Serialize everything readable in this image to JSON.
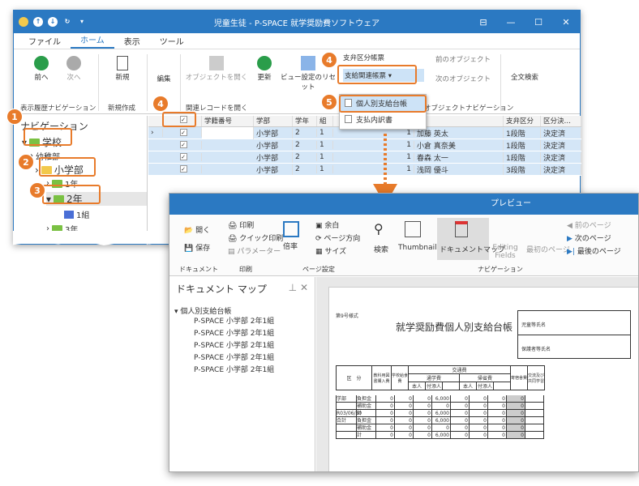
{
  "window": {
    "title": "児童生徒 - P-SPACE 就学奨励費ソフトウェア",
    "controls": [
      "⊟",
      "—",
      "☐",
      "✕"
    ]
  },
  "menu": [
    "ファイル",
    "ホーム",
    "表示",
    "ツール"
  ],
  "ribbon": {
    "back": "前へ",
    "forward": "次へ",
    "new": "新規",
    "edit": "編集",
    "open_object": "オブジェクトを開く",
    "refresh": "更新",
    "view_settings": "ビュー設定のリセット",
    "subsidy_books": "支弁区分帳票",
    "payment_books": "支給関連帳票",
    "prev_object": "前のオブジェクト",
    "next_object": "次のオブジェクト",
    "full_search": "全文検索",
    "group_history": "表示履歴ナビゲーション",
    "group_new": "新規作成",
    "group_related": "関連レコードを開く",
    "group_obj_nav": "オブジェクトナビゲーション"
  },
  "dropdown": {
    "item1": "個人別支給台帳",
    "item2": "支払内訳書"
  },
  "nav": {
    "title": "ナビゲーション",
    "nodes": [
      "学校",
      "幼稚部",
      "小学部",
      "1年",
      "2年",
      "1組",
      "3年"
    ]
  },
  "grid": {
    "headers": [
      "",
      "学籍番号",
      "学部",
      "学年",
      "組",
      "",
      "",
      "支弁区分",
      "区分決…"
    ],
    "rows": [
      [
        "小学部",
        "2",
        "1",
        "1",
        "加藤 英太",
        "1段階",
        "決定済"
      ],
      [
        "小学部",
        "2",
        "1",
        "1",
        "小倉 真奈美",
        "1段階",
        "決定済"
      ],
      [
        "小学部",
        "2",
        "1",
        "1",
        "春森 太一",
        "1段階",
        "決定済"
      ],
      [
        "小学部",
        "2",
        "1",
        "1",
        "浅岡 優斗",
        "3段階",
        "決定済"
      ]
    ]
  },
  "badges": [
    "1",
    "2",
    "3",
    "4",
    "4",
    "5"
  ],
  "preview": {
    "title": "プレビュー",
    "open": "開く",
    "save": "保存",
    "print": "印刷",
    "quick_print": "クイック印刷",
    "params": "パラメーター",
    "margin": "余白",
    "page_dir": "ページ方向",
    "size": "サイズ",
    "zoom": "倍率",
    "search": "検索",
    "thumbnails": "Thumbnails",
    "docmap": "ドキュメントマップ",
    "editing": "Editing Fields",
    "first_page": "最初のページ",
    "prev_page": "前のページ",
    "next_page": "次のページ",
    "last_page": "最後のページ",
    "g_doc": "ドキュメント",
    "g_print": "印刷",
    "g_page": "ページ設定",
    "g_nav": "ナビゲーション",
    "docmap_title": "ドキュメント マップ",
    "root": "個人別支給台帳",
    "items": [
      "P-SPACE 小学部 2年1組",
      "P-SPACE 小学部 2年1組",
      "P-SPACE 小学部 2年1組",
      "P-SPACE 小学部 2年1組",
      "P-SPACE 小学部 2年1組"
    ],
    "report_title": "就学奨励費個人別支給台帳",
    "form_no": "第9号様式",
    "guardian": "児童等氏名",
    "parent": "保護者等氏名",
    "col_ku": "区　分",
    "col_a": "教科用図書購入費",
    "col_b": "学校給食費",
    "col_c": "交通費",
    "c1": "通学費",
    "c2": "帰省費",
    "c3": "本人",
    "c4": "付添人",
    "c5": "寄宿舎費",
    "c6": "交流及び共同学習",
    "row_labels": [
      "学部",
      "",
      "R03/06/30",
      "合計",
      "",
      ""
    ],
    "row_types": [
      "負担金",
      "補助金",
      "計",
      "負担金",
      "補助金",
      "計"
    ],
    "amount": "6,000"
  }
}
